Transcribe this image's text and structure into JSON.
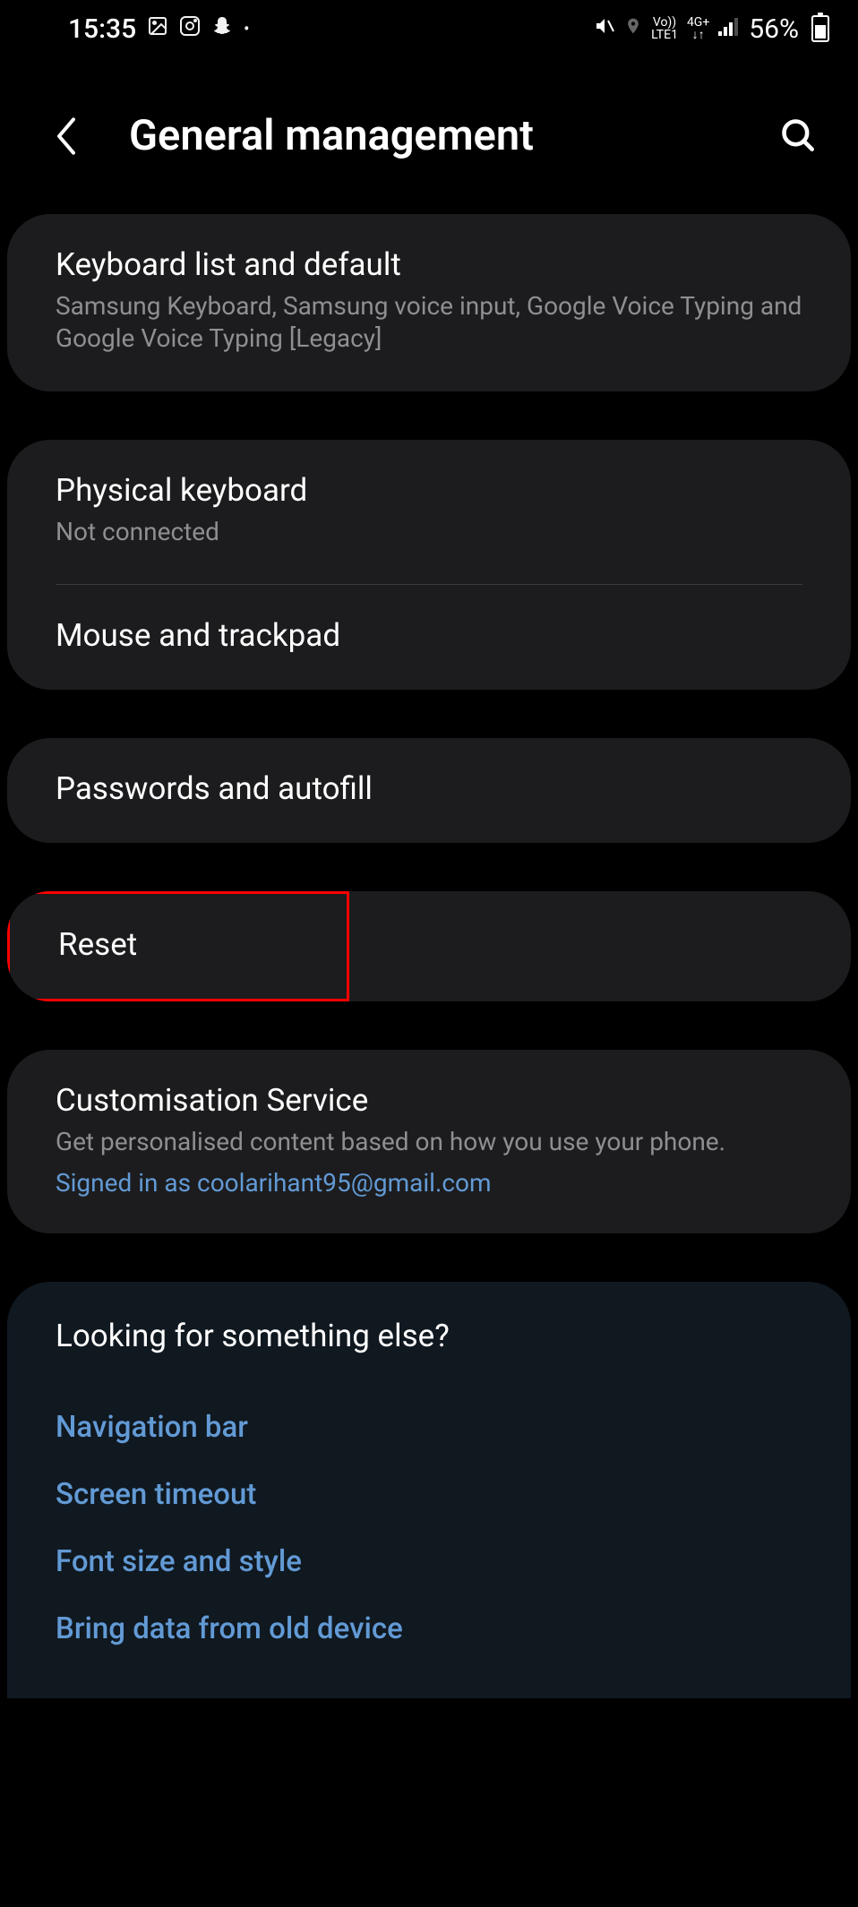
{
  "status_bar": {
    "time": "15:35",
    "battery_percent": "56%",
    "network_label_1": "Vo))",
    "network_label_2": "LTE1",
    "network_label_3": "4G+"
  },
  "header": {
    "title": "General management"
  },
  "card1": {
    "title": "Keyboard list and default",
    "subtitle": "Samsung Keyboard, Samsung voice input, Google Voice Typing and Google Voice Typing [Legacy]"
  },
  "card2": {
    "item1_title": "Physical keyboard",
    "item1_subtitle": "Not connected",
    "item2_title": "Mouse and trackpad"
  },
  "card3": {
    "title": "Passwords and autofill"
  },
  "card4": {
    "title": "Reset"
  },
  "card5": {
    "title": "Customisation Service",
    "subtitle": "Get personalised content based on how you use your phone.",
    "link": "Signed in as coolarihant95@gmail.com"
  },
  "suggestions": {
    "title": "Looking for something else?",
    "links": [
      "Navigation bar",
      "Screen timeout",
      "Font size and style",
      "Bring data from old device"
    ]
  }
}
